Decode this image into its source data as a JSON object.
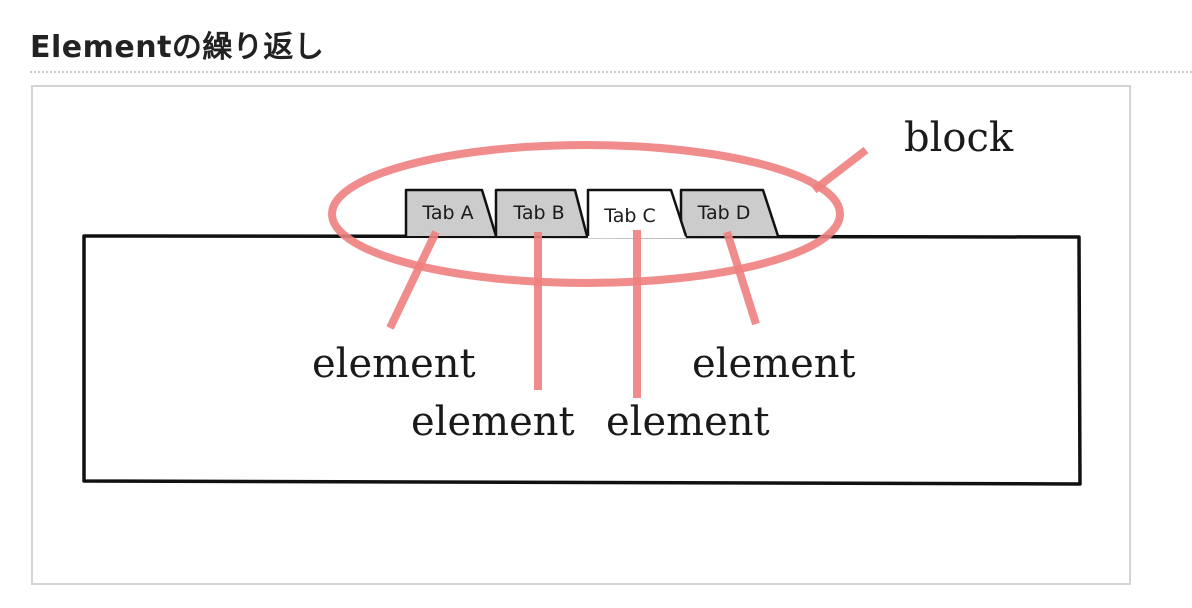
{
  "section": {
    "heading": "Elementの繰り返し"
  },
  "diagram": {
    "block_label": "block",
    "tabs": [
      {
        "label": "Tab A",
        "state": "inactive"
      },
      {
        "label": "Tab B",
        "state": "inactive"
      },
      {
        "label": "Tab C",
        "state": "active"
      },
      {
        "label": "Tab D",
        "state": "inactive"
      }
    ],
    "element_labels": [
      "element",
      "element",
      "element",
      "element"
    ],
    "colors": {
      "highlight": "#f08080",
      "inactive_tab_fill": "#cccccc",
      "active_tab_fill": "#ffffff",
      "outline": "#111111"
    }
  }
}
